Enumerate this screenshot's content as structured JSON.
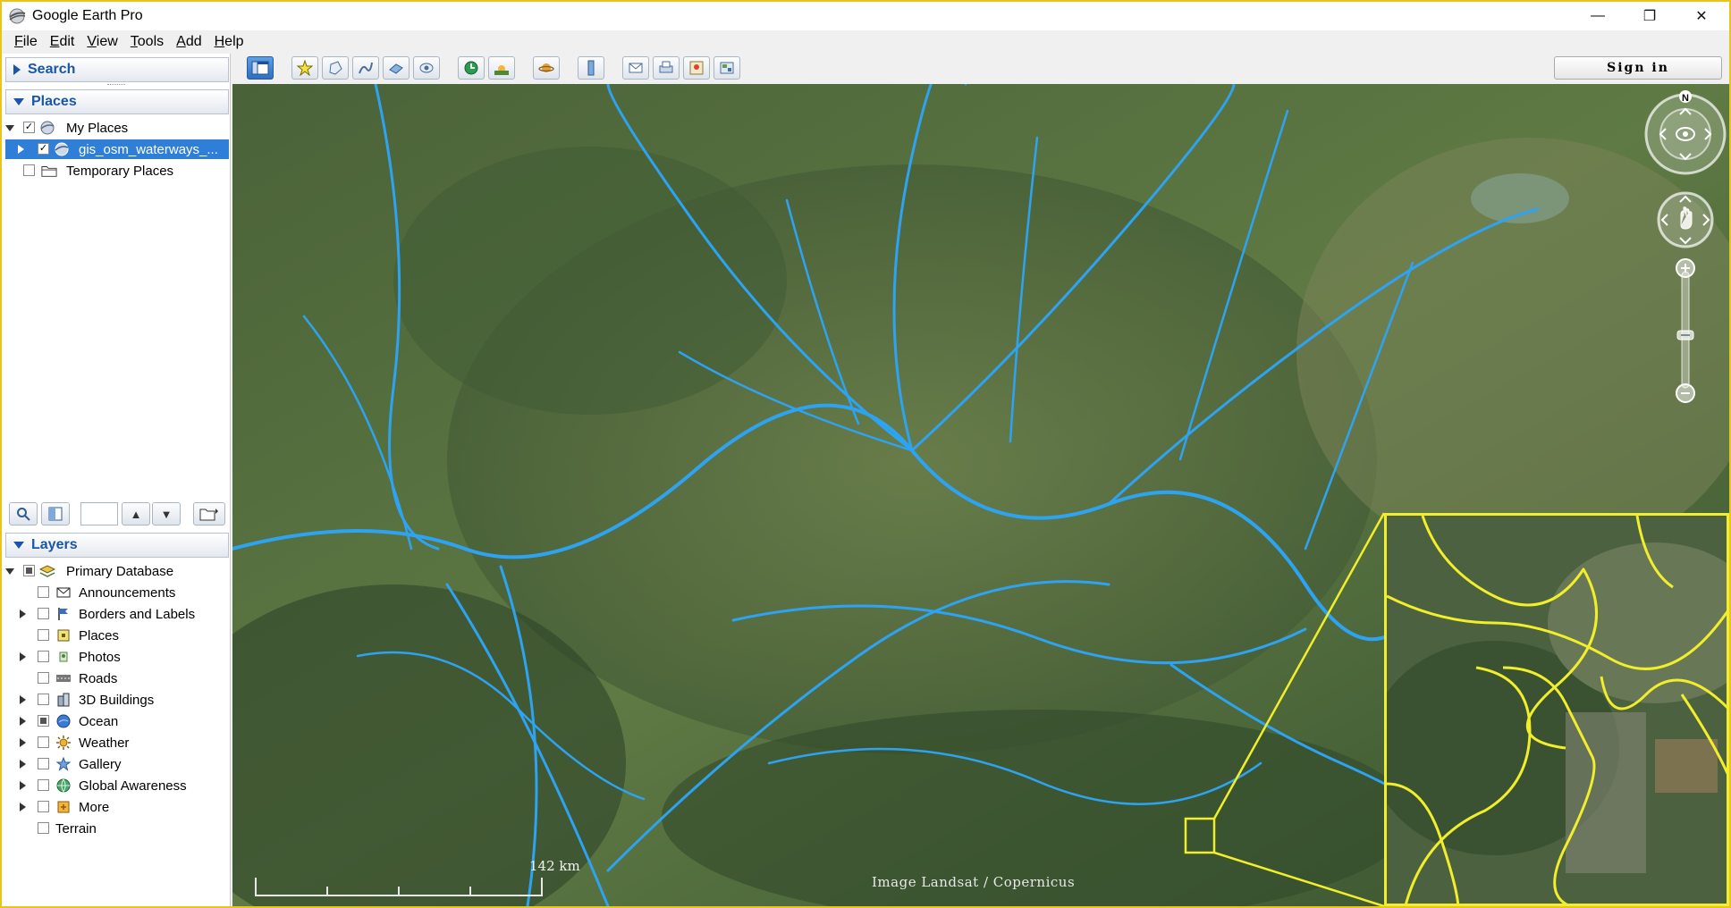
{
  "window": {
    "title": "Google Earth Pro",
    "minimize": "—",
    "restore": "❐",
    "close": "✕"
  },
  "menu": {
    "items": [
      "File",
      "Edit",
      "View",
      "Tools",
      "Add",
      "Help"
    ],
    "mnemonics": [
      "F",
      "E",
      "V",
      "T",
      "A",
      "H"
    ]
  },
  "toolbar": {
    "sign_in": "Sign in"
  },
  "search_panel": {
    "title": "Search"
  },
  "places_panel": {
    "title": "Places",
    "items": [
      {
        "label": "My Places",
        "checked": true
      },
      {
        "label": "gis_osm_waterways_...",
        "checked": true,
        "selected": true
      },
      {
        "label": "Temporary Places",
        "checked": false
      }
    ]
  },
  "layers_panel": {
    "title": "Layers",
    "root": "Primary Database",
    "items": [
      {
        "label": "Announcements",
        "icon": "envelope-icon",
        "expandable": false
      },
      {
        "label": "Borders and Labels",
        "icon": "flag-icon",
        "expandable": true
      },
      {
        "label": "Places",
        "icon": "place-square-icon",
        "expandable": false
      },
      {
        "label": "Photos",
        "icon": "photo-icon",
        "expandable": true
      },
      {
        "label": "Roads",
        "icon": "road-icon",
        "expandable": false
      },
      {
        "label": "3D Buildings",
        "icon": "buildings-icon",
        "expandable": true
      },
      {
        "label": "Ocean",
        "icon": "ocean-globe-icon",
        "expandable": true,
        "partial": true
      },
      {
        "label": "Weather",
        "icon": "sun-icon",
        "expandable": true
      },
      {
        "label": "Gallery",
        "icon": "star-icon",
        "expandable": true
      },
      {
        "label": "Global Awareness",
        "icon": "globe-icon",
        "expandable": true
      },
      {
        "label": "More",
        "icon": "more-square-icon",
        "expandable": true
      }
    ],
    "terrain": "Terrain"
  },
  "map": {
    "scale_label": "142 km",
    "attribution": "Image Landsat / Copernicus",
    "compass_north": "N",
    "waterway_color": "#2ea3f2",
    "highlight_color": "#f1ee2b"
  }
}
